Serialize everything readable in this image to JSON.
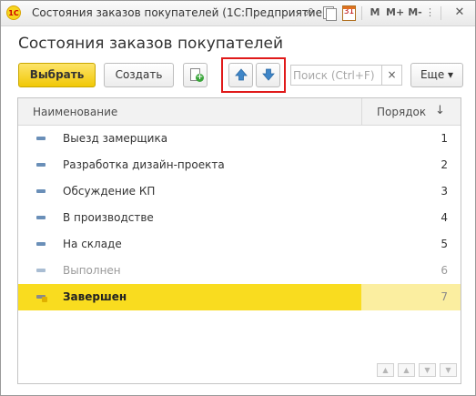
{
  "window": {
    "title": "Состояния заказов покупателей  (1С:Предприятие)",
    "controls": [
      "M",
      "M+",
      "M-"
    ]
  },
  "page": {
    "title": "Состояния заказов покупателей"
  },
  "toolbar": {
    "select_label": "Выбрать",
    "create_label": "Создать",
    "search_placeholder": "Поиск (Ctrl+F)",
    "clear_label": "×",
    "more_label": "Еще ▾"
  },
  "table": {
    "columns": {
      "name": "Наименование",
      "order": "Порядок",
      "sort_indicator": "↓"
    },
    "rows": [
      {
        "name": "Выезд замерщика",
        "order": "1"
      },
      {
        "name": "Разработка дизайн-проекта",
        "order": "2"
      },
      {
        "name": "Обсуждение КП",
        "order": "3"
      },
      {
        "name": "В производстве",
        "order": "4"
      },
      {
        "name": "На складе",
        "order": "5"
      },
      {
        "name": "Выполнен",
        "order": "6"
      },
      {
        "name": "Завершен",
        "order": "7"
      }
    ],
    "selected_row": "Завершен"
  },
  "colors": {
    "accent_yellow": "#f9dc1f",
    "highlight_red": "#e01a1a",
    "arrow_blue": "#3f86c8"
  }
}
